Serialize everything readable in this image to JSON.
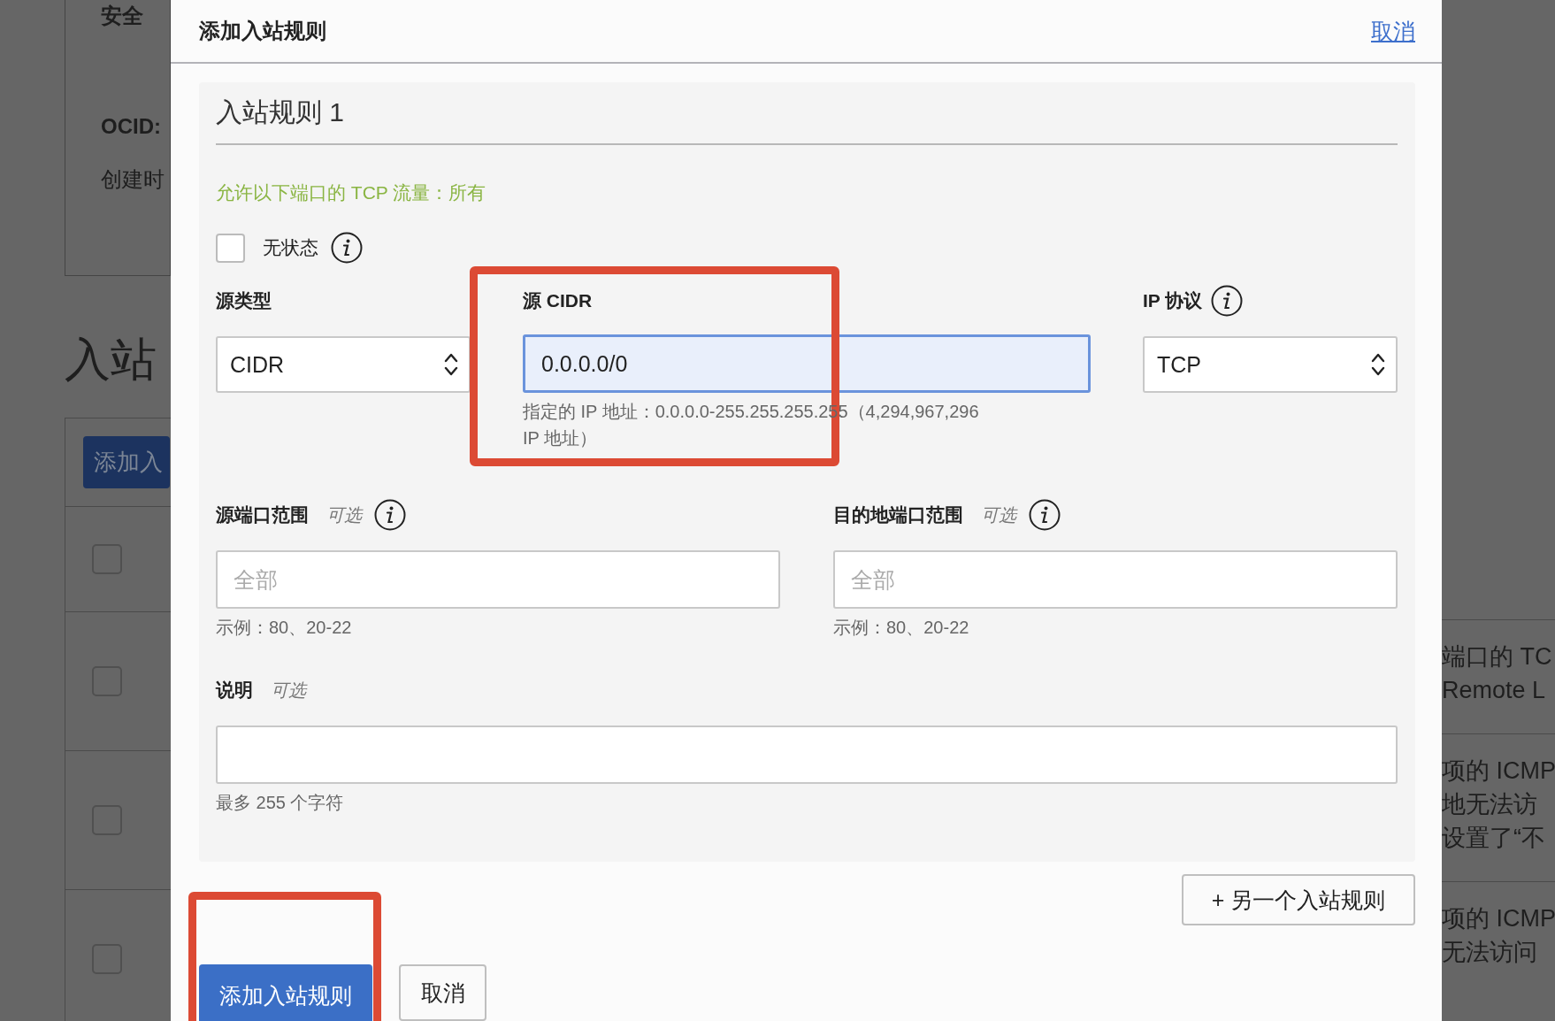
{
  "backdrop": {
    "section_title": "安全",
    "ocid_label": "OCID:",
    "created_label": "创建时",
    "heading": "入站",
    "add_button": "添加入",
    "rows": [
      {
        "checked": false
      },
      {
        "checked": false
      },
      {
        "checked": false
      },
      {
        "checked": false
      }
    ],
    "right_rows": [
      {
        "lines": [
          "端口的 TC",
          "Remote L"
        ]
      },
      {
        "lines": [
          "项的 ICMP",
          "地无法访",
          "设置了“不"
        ]
      },
      {
        "lines": [
          "项的 ICMP",
          "无法访问"
        ]
      }
    ]
  },
  "dialog": {
    "title": "添加入站规则",
    "cancel_link": "取消",
    "rules": [
      {
        "title": "入站规则 1",
        "summary": "允许以下端口的 TCP 流量：所有",
        "stateless": {
          "label": "无状态",
          "checked": false
        },
        "source_type": {
          "label": "源类型",
          "value": "CIDR"
        },
        "source_cidr": {
          "label": "源 CIDR",
          "value": "0.0.0.0/0",
          "focused": true,
          "highlighted": true,
          "help": "指定的 IP 地址：0.0.0.0-255.255.255.255（4,294,967,296 IP 地址）"
        },
        "ip_protocol": {
          "label": "IP 协议",
          "value": "TCP"
        },
        "source_port": {
          "label": "源端口范围",
          "optional": "可选",
          "placeholder": "全部",
          "help": "示例：80、20-22"
        },
        "dest_port": {
          "label": "目的地端口范围",
          "optional": "可选",
          "placeholder": "全部",
          "help": "示例：80、20-22"
        },
        "description": {
          "label": "说明",
          "optional": "可选",
          "help": "最多 255 个字符"
        }
      }
    ],
    "add_another_button": "+ 另一个入站规则",
    "submit_button": {
      "label": "添加入站规则",
      "highlighted": true
    },
    "cancel_button": "取消"
  }
}
